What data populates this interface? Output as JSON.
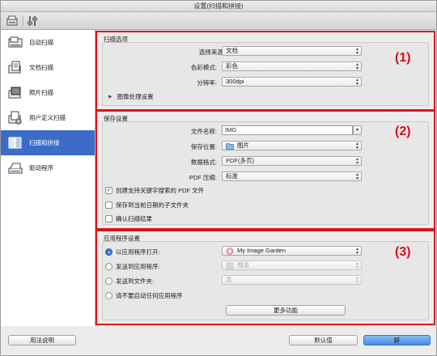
{
  "window": {
    "title": "设置(扫描和拼接)"
  },
  "toolbar": {
    "items": [
      {
        "name": "scan-settings-tab-icon"
      },
      {
        "name": "general-settings-tab-icon"
      }
    ]
  },
  "sidebar": {
    "items": [
      {
        "label": "自动扫描",
        "icon": "auto-scan-icon"
      },
      {
        "label": "文档扫描",
        "icon": "document-scan-icon"
      },
      {
        "label": "照片扫描",
        "icon": "photo-scan-icon"
      },
      {
        "label": "用户定义扫描",
        "icon": "custom-scan-icon"
      },
      {
        "label": "扫描和拼接",
        "icon": "stitch-scan-icon",
        "active": true
      },
      {
        "label": "驱动程序",
        "icon": "driver-icon"
      }
    ]
  },
  "scan_options": {
    "title": "扫描选项",
    "marker": "(1)",
    "source_label": "选择来源:",
    "source_value": "文档",
    "color_mode_label": "色彩模式:",
    "color_mode_value": "彩色",
    "resolution_label": "分辨率:",
    "resolution_value": "300dpi",
    "image_processing_label": "图像处理设置"
  },
  "save_settings": {
    "title": "保存设置",
    "marker": "(2)",
    "filename_label": "文件名称:",
    "filename_value": "IMG",
    "location_label": "保存位置:",
    "location_value": "图片",
    "format_label": "数据格式:",
    "format_value": "PDF(多页)",
    "pdf_compression_label": "PDF 压缩:",
    "pdf_compression_value": "标准",
    "checkbox_keyword_pdf": "创建支持关键字搜索的 PDF 文件",
    "checkbox_keyword_pdf_checked": true,
    "checkbox_date_subfolder": "保存到当前日期的子文件夹",
    "checkbox_date_subfolder_checked": false,
    "checkbox_confirm_results": "确认扫描结果",
    "checkbox_confirm_results_checked": false
  },
  "app_settings": {
    "title": "应用程序设置",
    "marker": "(3)",
    "radio_open_with": "以应用程序打开:",
    "open_with_value": "My Image Garden",
    "radio_send_to_app": "发送到应用程序:",
    "send_to_app_value": "预览",
    "radio_send_to_folder": "发送到文件夹:",
    "send_to_folder_value": "无",
    "radio_no_app": "请不要启动任何应用程序",
    "selected": "open_with",
    "more_functions_button": "更多功能"
  },
  "footer": {
    "instructions_button": "用法说明",
    "defaults_button": "默认值",
    "ok_button": "好"
  },
  "colors": {
    "accent": "#3c6cc8",
    "highlight_box": "#e0121a"
  }
}
